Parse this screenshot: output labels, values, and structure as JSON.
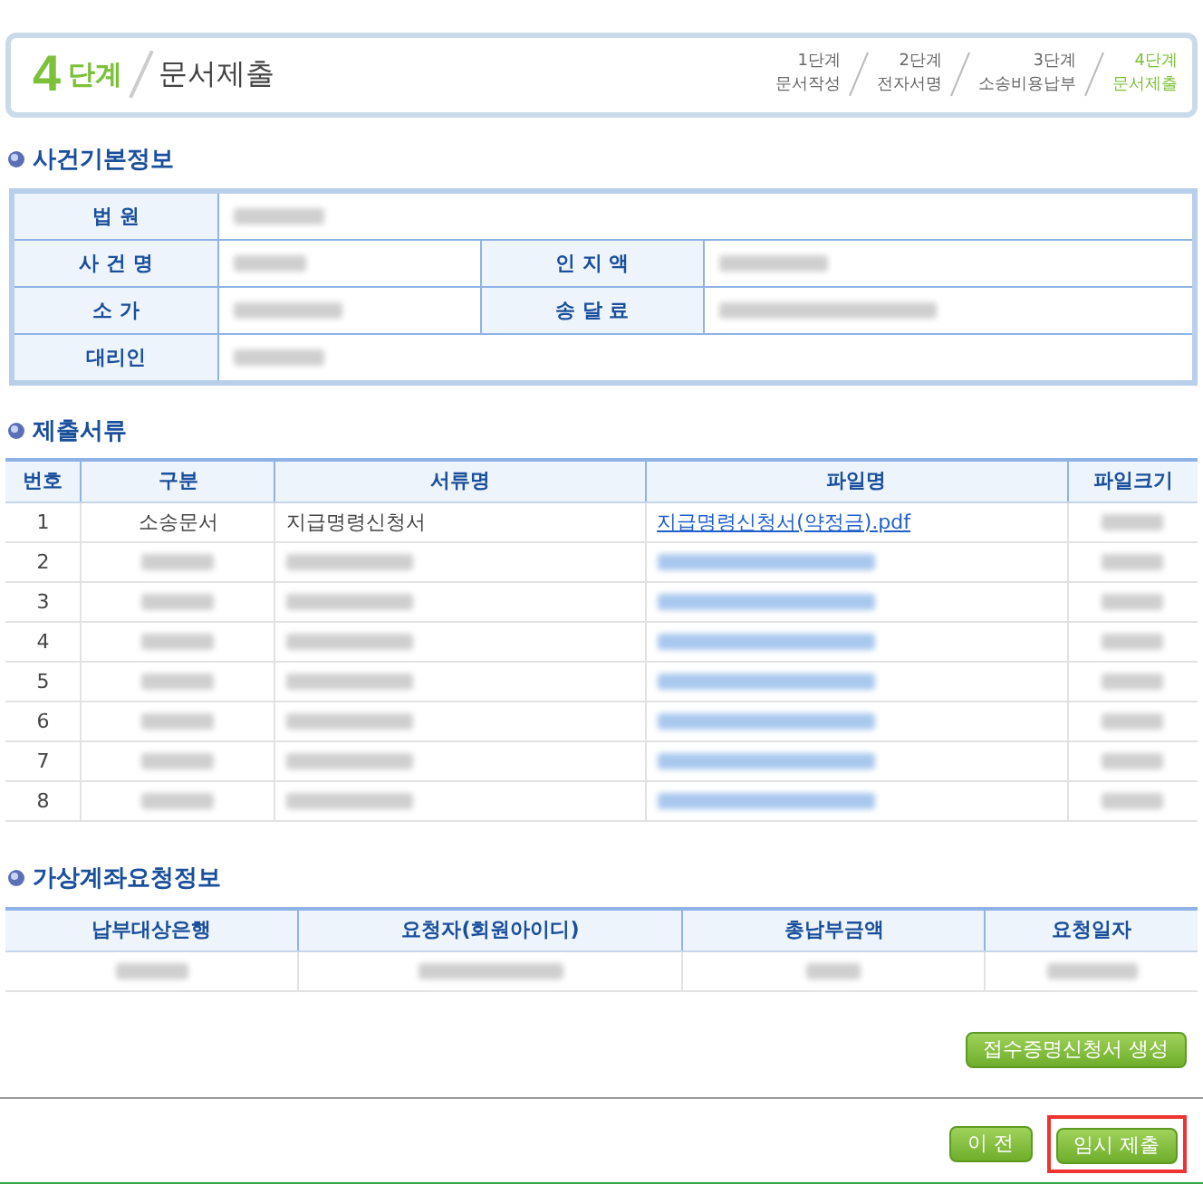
{
  "header": {
    "step_number": "4",
    "step_word": "단계",
    "title": "문서제출",
    "steps": [
      {
        "step": "1단계",
        "label": "문서작성",
        "selected": false
      },
      {
        "step": "2단계",
        "label": "전자서명",
        "selected": false
      },
      {
        "step": "3단계",
        "label": "소송비용납부",
        "selected": false
      },
      {
        "step": "4단계",
        "label": "문서제출",
        "selected": true
      }
    ]
  },
  "case_info": {
    "title": "사건기본정보",
    "rows": [
      {
        "cells": [
          {
            "label": "법 원"
          }
        ]
      },
      {
        "cells": [
          {
            "label": "사 건 명"
          },
          {
            "label": "인 지 액"
          }
        ]
      },
      {
        "cells": [
          {
            "label": "소 가"
          },
          {
            "label": "송 달 료"
          }
        ]
      },
      {
        "cells": [
          {
            "label": "대리인"
          }
        ]
      }
    ]
  },
  "documents": {
    "title": "제출서류",
    "columns": [
      "번호",
      "구분",
      "서류명",
      "파일명",
      "파일크기"
    ],
    "rows": [
      {
        "number": "1",
        "category": "소송문서",
        "doc_name": "지급명령신청서",
        "file_name": "지급명령신청서(약정금).pdf"
      },
      {
        "number": "2"
      },
      {
        "number": "3"
      },
      {
        "number": "4"
      },
      {
        "number": "5"
      },
      {
        "number": "6"
      },
      {
        "number": "7"
      },
      {
        "number": "8"
      }
    ]
  },
  "virtual_account": {
    "title": "가상계좌요청정보",
    "columns": [
      "납부대상은행",
      "요청자(회원아이디)",
      "총납부금액",
      "요청일자"
    ]
  },
  "buttons": {
    "certificate": "접수증명신청서 생성",
    "previous": "이 전",
    "submit": "임시 제출"
  }
}
